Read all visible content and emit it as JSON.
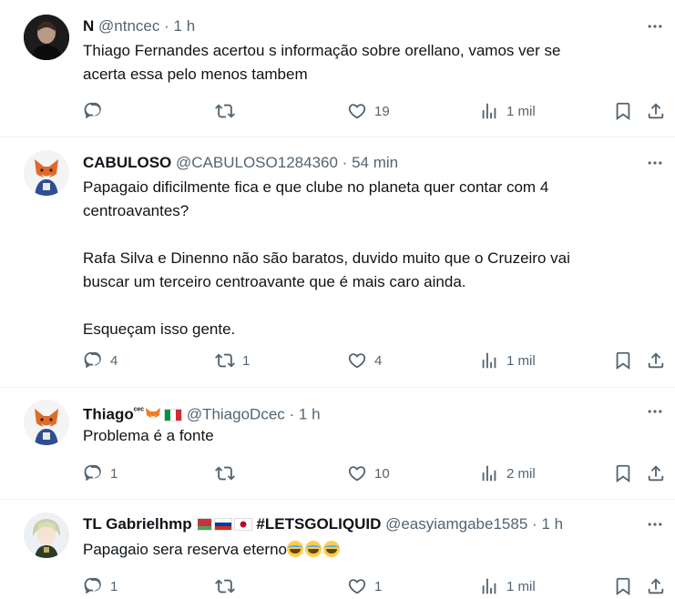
{
  "tweets": [
    {
      "name": "N",
      "handle": "@ntncec",
      "dot": "·",
      "time": "1 h",
      "lines": [
        "Thiago Fernandes acertou s informação sobre orellano, vamos ver se",
        "acerta essa pelo menos tambem"
      ],
      "reply_count": "",
      "retweet_count": "",
      "like_count": "19",
      "views": "1 mil"
    },
    {
      "name": "CABULOSO",
      "handle": "@CABULOSO1284360",
      "dot": "·",
      "time": "54 min",
      "lines": [
        "Papagaio dificilmente fica e que clube no planeta quer contar com 4",
        "centroavantes?",
        "",
        "Rafa Silva e Dinenno não são baratos, duvido muito que o Cruzeiro vai",
        "buscar um terceiro centroavante que é mais caro ainda.",
        "",
        "Esqueçam isso gente."
      ],
      "reply_count": "4",
      "retweet_count": "1",
      "like_count": "4",
      "views": "1 mil"
    },
    {
      "name": "Thiago",
      "name_sup": "ᶜᵉᶜ",
      "handle": "@ThiagoDcec",
      "dot": "·",
      "time": "1 h",
      "lines": [
        "Problema é a fonte"
      ],
      "reply_count": "1",
      "retweet_count": "",
      "like_count": "10",
      "views": "2 mil"
    },
    {
      "name": "TL Gabrielhmp",
      "name_tag": "#LETSGOLIQUID",
      "handle": "@easyiamgabe1585",
      "dot": "·",
      "time": "1 h",
      "lines": [
        "Papagaio sera reserva eterno"
      ],
      "reply_count": "1",
      "retweet_count": "",
      "like_count": "1",
      "views": "1 mil"
    }
  ],
  "icons": [
    "more-icon",
    "reply-icon",
    "retweet-icon",
    "like-icon",
    "views-icon",
    "bookmark-icon",
    "share-icon",
    "fox-emoji-icon",
    "italy-flag-icon",
    "belarus-flag-icon",
    "russia-flag-icon",
    "japan-flag-icon",
    "tears-of-joy-emoji-icon"
  ],
  "colors": {
    "text": "#0f1419",
    "secondary": "#536471",
    "divider": "#eff3f4"
  }
}
